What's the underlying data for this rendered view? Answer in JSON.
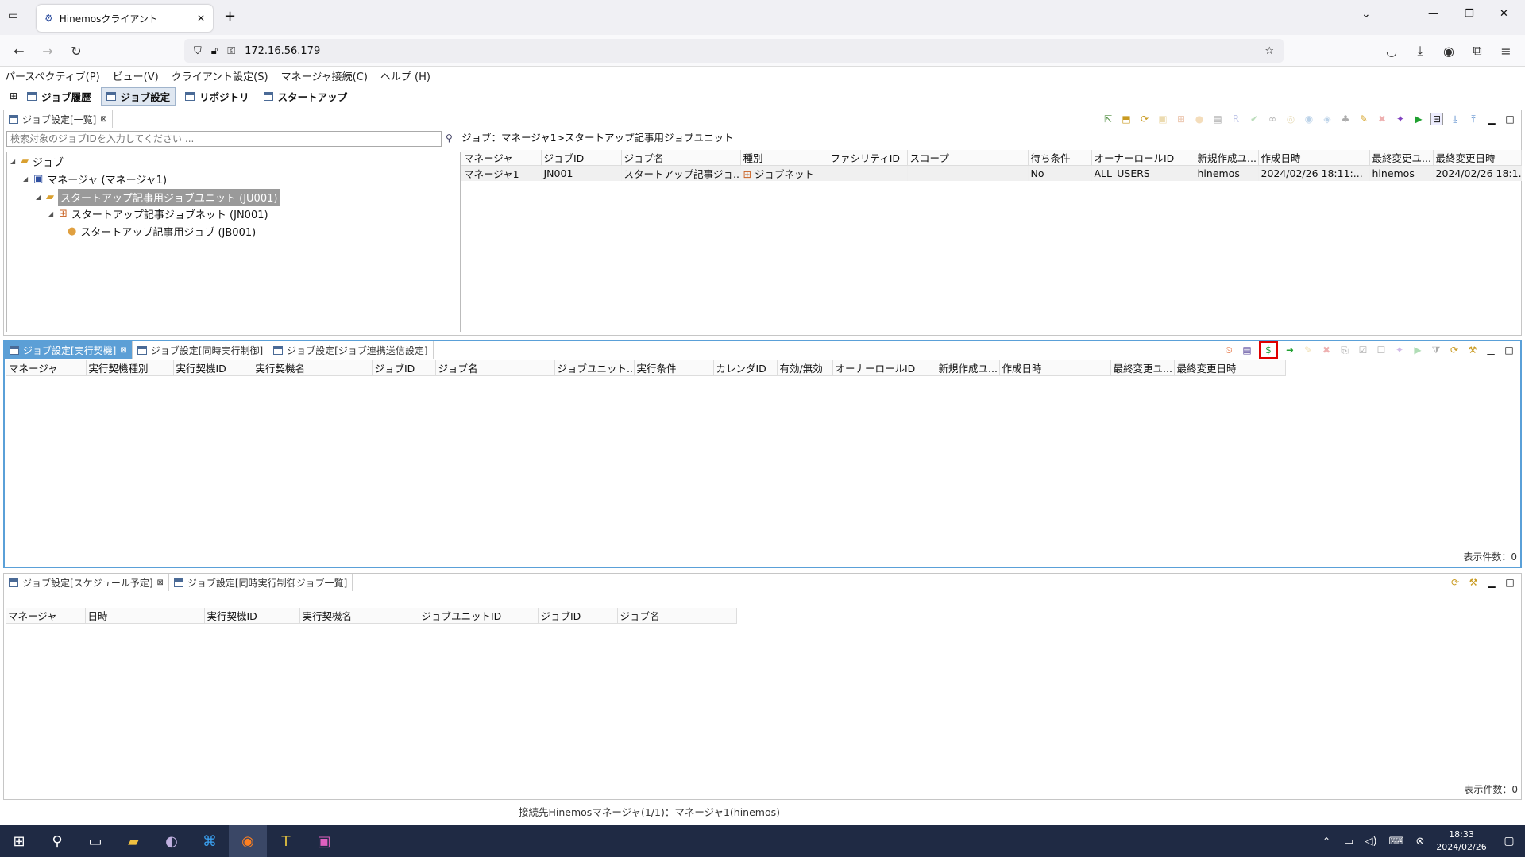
{
  "browser": {
    "tab_title": "Hinemosクライアント",
    "url": "172.16.56.179"
  },
  "menu": [
    "パースペクティブ(P)",
    "ビュー(V)",
    "クライアント設定(S)",
    "マネージャ接続(C)",
    "ヘルプ (H)"
  ],
  "perspectives": [
    "ジョブ履歴",
    "ジョブ設定",
    "リポジトリ",
    "スタートアップ"
  ],
  "top_view": {
    "tab": "ジョブ設定[一覧]",
    "search_placeholder": "検索対象のジョブIDを入力してください ...",
    "breadcrumb": "ジョブ：マネージャ1>スタートアップ記事用ジョブユニット",
    "tree": [
      "ジョブ",
      "マネージャ (マネージャ1)",
      "スタートアップ記事用ジョブユニット (JU001)",
      "スタートアップ記事ジョブネット (JN001)",
      "スタートアップ記事用ジョブ (JB001)"
    ],
    "columns": [
      "マネージャ",
      "ジョブID",
      "ジョブ名",
      "種別",
      "ファシリティID",
      "スコープ",
      "待ち条件",
      "オーナーロールID",
      "新規作成ユ...",
      "作成日時",
      "最終変更ユ...",
      "最終変更日時"
    ],
    "rows": [
      [
        "マネージャ1",
        "JN001",
        "スタートアップ記事ジョ...",
        "ジョブネット",
        "",
        "",
        "No",
        "ALL_USERS",
        "hinemos",
        "2024/02/26 18:11:...",
        "hinemos",
        "2024/02/26 18:1..."
      ]
    ]
  },
  "mid_view": {
    "tabs": [
      "ジョブ設定[実行契機]",
      "ジョブ設定[同時実行制御]",
      "ジョブ設定[ジョブ連携送信設定]"
    ],
    "columns": [
      "マネージャ",
      "実行契機種別",
      "実行契機ID",
      "実行契機名",
      "ジョブID",
      "ジョブ名",
      "ジョブユニット...",
      "実行条件",
      "カレンダID",
      "有効/無効",
      "オーナーロールID",
      "新規作成ユ...",
      "作成日時",
      "最終変更ユ...",
      "最終変更日時"
    ],
    "count": "表示件数：0"
  },
  "bottom_view": {
    "tabs": [
      "ジョブ設定[スケジュール予定]",
      "ジョブ設定[同時実行制御ジョブ一覧]"
    ],
    "columns": [
      "マネージャ",
      "日時",
      "実行契機ID",
      "実行契機名",
      "ジョブユニットID",
      "ジョブID",
      "ジョブ名"
    ],
    "count": "表示件数：0"
  },
  "status": "接続先Hinemosマネージャ(1/1)：マネージャ1(hinemos)",
  "clock": {
    "time": "18:33",
    "date": "2024/02/26"
  },
  "colors": {
    "accent": "#5c9fd6",
    "highlight": "#e00000"
  }
}
